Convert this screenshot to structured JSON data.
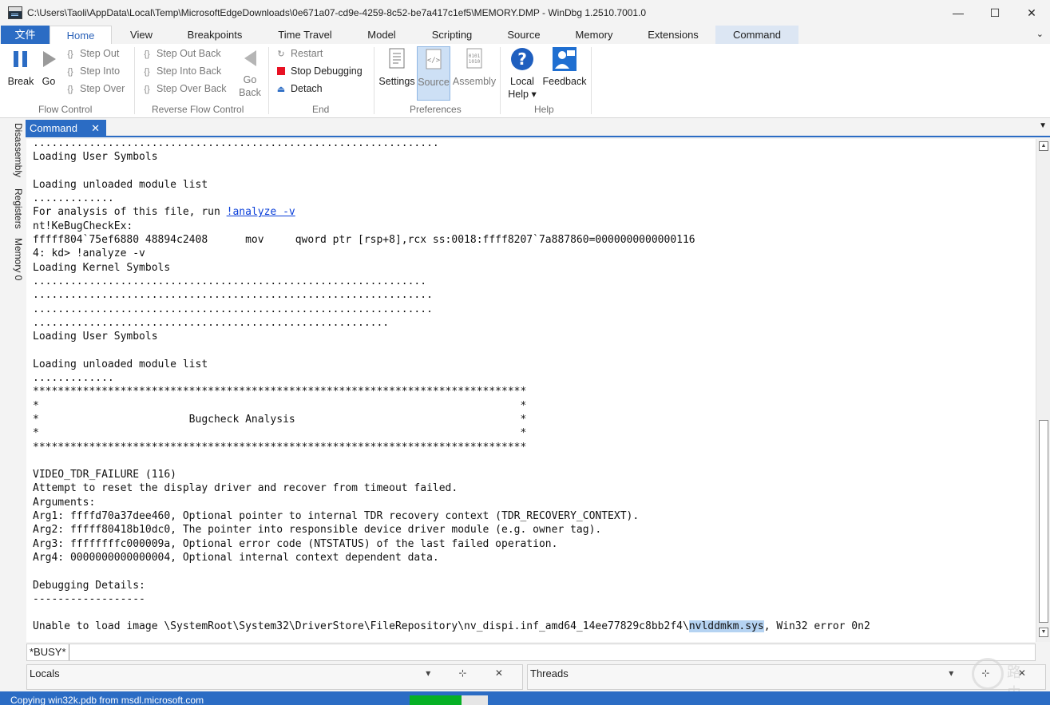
{
  "window": {
    "title": "C:\\Users\\Taoli\\AppData\\Local\\Temp\\MicrosoftEdgeDownloads\\0e671a07-cd9e-4259-8c52-be7a417c1ef5\\MEMORY.DMP - WinDbg 1.2510.7001.0",
    "min": "—",
    "max": "☐",
    "close": "✕"
  },
  "tabs": {
    "file": "文件",
    "home": "Home",
    "view": "View",
    "breakpoints": "Breakpoints",
    "time_travel": "Time Travel",
    "model": "Model",
    "scripting": "Scripting",
    "source": "Source",
    "memory": "Memory",
    "extensions": "Extensions",
    "command": "Command",
    "chevron": "⌄"
  },
  "ribbon": {
    "flow_control": {
      "label": "Flow Control",
      "break": "Break",
      "go": "Go",
      "step_out": "Step Out",
      "step_into": "Step Into",
      "step_over": "Step Over"
    },
    "reverse_flow": {
      "label": "Reverse Flow Control",
      "step_out_back": "Step Out Back",
      "step_into_back": "Step Into Back",
      "step_over_back": "Step Over Back",
      "go_back_1": "Go",
      "go_back_2": "Back"
    },
    "end": {
      "label": "End",
      "restart": "Restart",
      "stop": "Stop Debugging",
      "detach": "Detach"
    },
    "preferences": {
      "label": "Preferences",
      "settings": "Settings",
      "source": "Source",
      "assembly": "Assembly"
    },
    "help": {
      "label": "Help",
      "local_help_1": "Local",
      "local_help_2": "Help ▾",
      "feedback": "Feedback"
    }
  },
  "side_tabs": {
    "disassembly": "Disassembly",
    "registers": "Registers",
    "memory": "Memory 0"
  },
  "command_window": {
    "tab": "Command",
    "close": "✕",
    "menu": "▼",
    "lines_before_link": ".................................................................\nLoading User Symbols\n\nLoading unloaded module list\n.............\nFor analysis of this file, run ",
    "link": "!analyze -v",
    "lines_mid": "\nnt!KeBugCheckEx:\nfffff804`75ef6880 48894c2408      mov     qword ptr [rsp+8],rcx ss:0018:ffff8207`7a887860=0000000000000116\n4: kd> !analyze -v\nLoading Kernel Symbols\n...............................................................\n................................................................\n................................................................\n.........................................................\nLoading User Symbols\n\nLoading unloaded module list\n.............\n*******************************************************************************\n*                                                                             *\n*                        Bugcheck Analysis                                    *\n*                                                                             *\n*******************************************************************************\n\nVIDEO_TDR_FAILURE (116)\nAttempt to reset the display driver and recover from timeout failed.\nArguments:\nArg1: ffffd70a37dee460, Optional pointer to internal TDR recovery context (TDR_RECOVERY_CONTEXT).\nArg2: fffff80418b10dc0, The pointer into responsible device driver module (e.g. owner tag).\nArg3: ffffffffc000009a, Optional error code (NTSTATUS) of the last failed operation.\nArg4: 0000000000000004, Optional internal context dependent data.\n\nDebugging Details:\n------------------\n\nUnable to load image \\SystemRoot\\System32\\DriverStore\\FileRepository\\nv_dispi.inf_amd64_14ee77829c8bb2f4\\",
    "highlight": "nvlddmkm.sys",
    "lines_after": ", Win32 error 0n2",
    "busy": "*BUSY*",
    "input_value": ""
  },
  "panels": {
    "locals": "Locals",
    "locals_btns": "▾ ⊹ ✕",
    "threads": "Threads",
    "threads_btns": "▾ ⊹ ✕"
  },
  "status": {
    "text": "Copying win32k.pdb from msdl.microsoft.com",
    "progress": 0.66
  },
  "watermark": {
    "text": "路由器"
  },
  "colors": {
    "accent": "#2b6cc4",
    "progress": "#06b025",
    "link": "#0a3fd9",
    "stop_red": "#e81123"
  }
}
